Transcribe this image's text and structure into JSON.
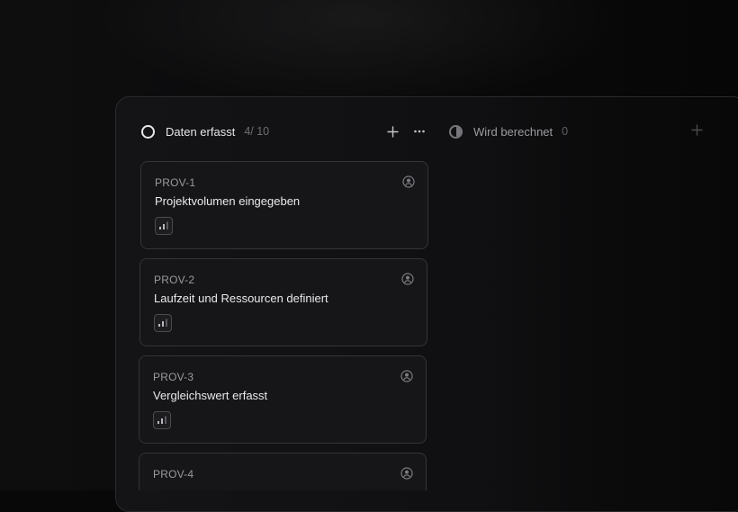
{
  "columns": [
    {
      "title": "Daten erfasst",
      "count": "4/ 10",
      "status_icon": "circle-outline-icon",
      "actions": [
        "plus-icon",
        "more-horizontal-icon"
      ],
      "cards": [
        {
          "id": "PROV-1",
          "title": "Projektvolumen eingegeben",
          "badge_icon": "bar-chart-icon",
          "assignee_icon": "user-circle-icon"
        },
        {
          "id": "PROV-2",
          "title": "Laufzeit und Ressourcen definiert",
          "badge_icon": "bar-chart-icon",
          "assignee_icon": "user-circle-icon"
        },
        {
          "id": "PROV-3",
          "title": "Vergleichswert erfasst",
          "badge_icon": "bar-chart-icon",
          "assignee_icon": "user-circle-icon"
        },
        {
          "id": "PROV-4",
          "title": "",
          "badge_icon": "bar-chart-icon",
          "assignee_icon": "user-circle-icon"
        }
      ]
    },
    {
      "title": "Wird berechnet",
      "count": "0",
      "status_icon": "circle-half-icon",
      "actions": [
        "plus-icon"
      ]
    }
  ],
  "colors": {
    "background": "#080808",
    "board": "#141416",
    "card": "#161618",
    "card_border": "#343438",
    "text_primary": "#eaeaec",
    "text_muted": "#6e6e74"
  }
}
